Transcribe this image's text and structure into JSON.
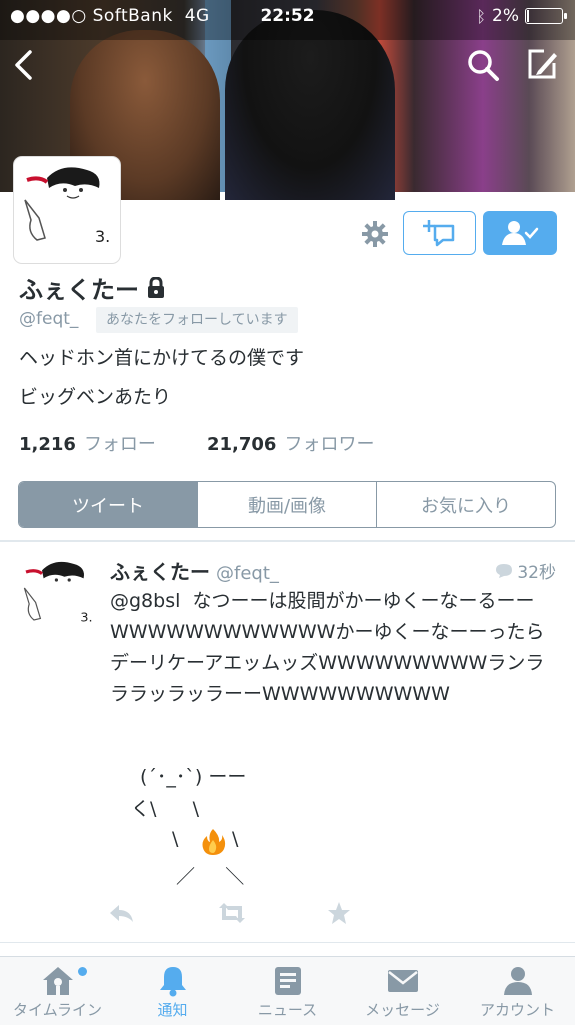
{
  "status_bar": {
    "carrier": "●●●●○ SoftBank",
    "network": "4G",
    "time": "22:52",
    "battery": "2%"
  },
  "profile": {
    "name": "ふぇくたー",
    "handle": "@feqt_",
    "follows_you": "あなたをフォローしています",
    "bio_line1": "ヘッドホン首にかけてるの僕です",
    "bio_line2": "ビッグベンあたり",
    "following_count": "1,216",
    "following_label": "フォロー",
    "followers_count": "21,706",
    "followers_label": "フォロワー"
  },
  "tabs": [
    "ツイート",
    "動画/画像",
    "お気に入り"
  ],
  "tweet": {
    "name": "ふぇくたー",
    "handle": "@feqt_",
    "time": "32秒",
    "text": "@g8bsl  なつーーは股間がかーゆくーなーるーーWWWWWWWWWWWWかーゆくーなーーったらデーリケーアエッムッズWWWWWWWWWランラララッラッラーーWWWWWWWWWW",
    "ascii_line1": "(´･_･`) ーー",
    "ascii_line2": "く\\      \\",
    "ascii_line3": "\\",
    "ascii_line4": "\\",
    "ascii_line5": "／     ＼"
  },
  "tabbar": [
    {
      "label": "タイムライン",
      "icon": "home-icon"
    },
    {
      "label": "通知",
      "icon": "bell-icon"
    },
    {
      "label": "ニュース",
      "icon": "news-icon"
    },
    {
      "label": "メッセージ",
      "icon": "mail-icon"
    },
    {
      "label": "アカウント",
      "icon": "person-icon"
    }
  ],
  "colors": {
    "accent": "#55acee",
    "muted": "#8899a6",
    "text": "#292f33"
  }
}
